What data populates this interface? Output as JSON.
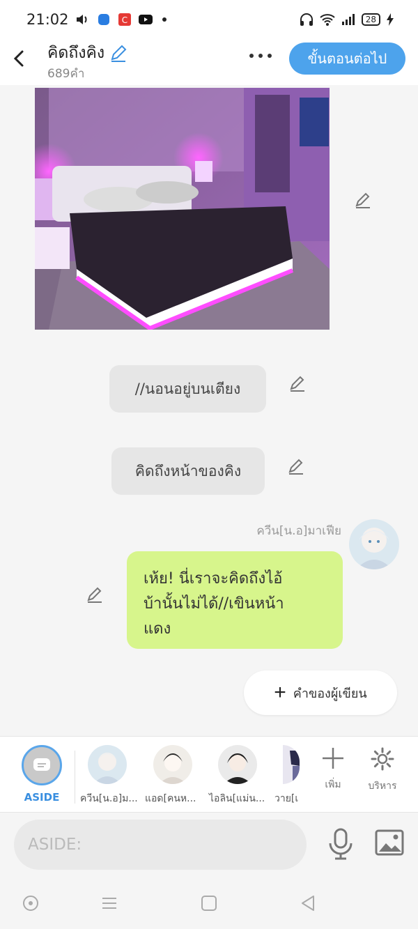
{
  "status": {
    "time": "21:02",
    "battery": "28"
  },
  "header": {
    "title": "คิดถึงคิง",
    "word_count": "689คำ",
    "next_label": "ขั้นตอนต่อไป"
  },
  "chat": {
    "narration_1": "//นอนอยู่บนเตียง",
    "narration_2": "คิดถึงหน้าของคิง",
    "character_name": "ควีน[น.อ]มาเฟีย",
    "message_lines": [
      "เห้ย!  นี่เราจะคิดถึงไอ้",
      "บ้านั้นไม่ได้//เขินหน้า",
      "แดง"
    ],
    "author_button": "คำของผู้เขียน"
  },
  "charbar": {
    "aside_label": "ASIDE",
    "characters": [
      "ควีน[น.อ]ม...",
      "แอด[คนห...",
      "ไอลิน[แม่น...",
      "วาย[เ"
    ],
    "add_label": "เพิ่ม",
    "manage_label": "บริหาร"
  },
  "input": {
    "placeholder": "ASIDE:"
  },
  "colors": {
    "accent": "#4da3ec",
    "bubble": "#d7f58c",
    "narration_bg": "#e6e6e6"
  }
}
